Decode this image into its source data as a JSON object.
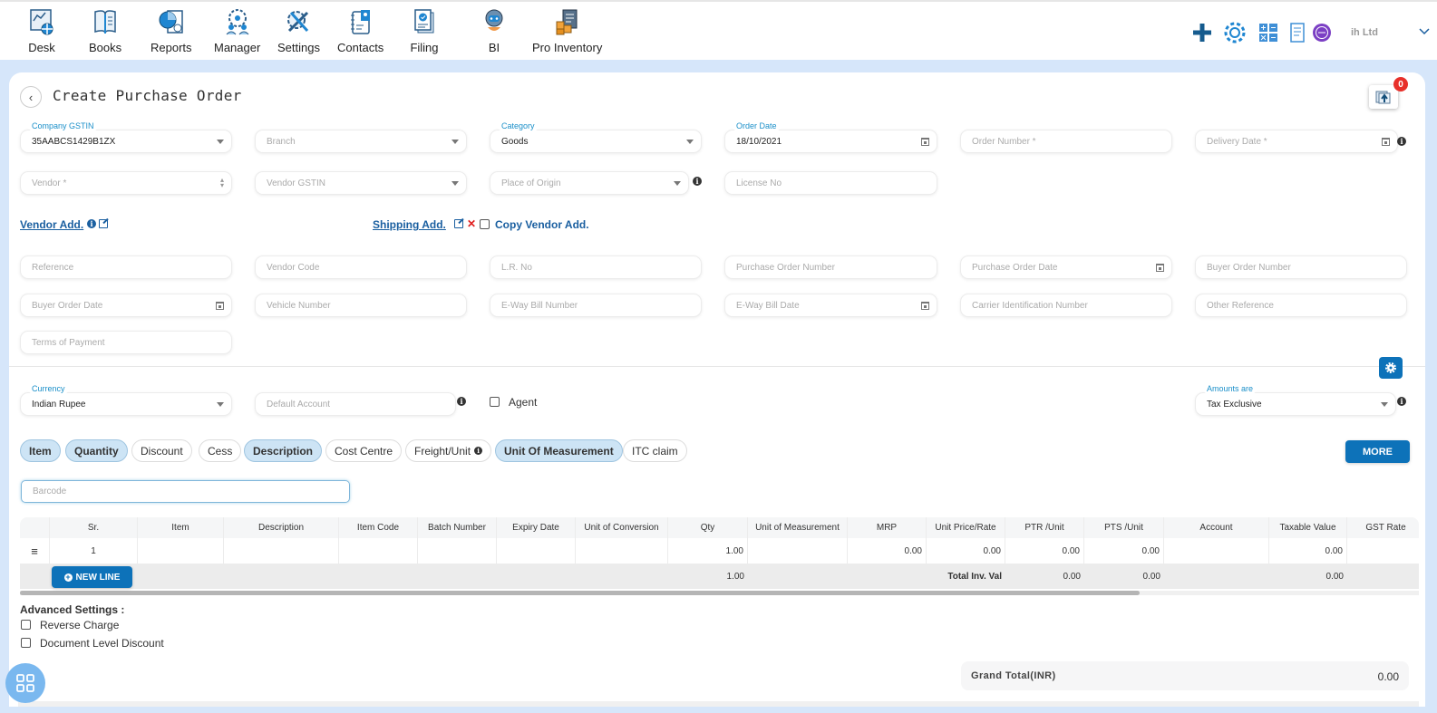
{
  "nav": {
    "items": [
      {
        "label": "Desk",
        "icon": "desk-icon"
      },
      {
        "label": "Books",
        "icon": "books-icon"
      },
      {
        "label": "Reports",
        "icon": "reports-icon"
      },
      {
        "label": "Manager",
        "icon": "manager-icon"
      },
      {
        "label": "Settings",
        "icon": "settings-icon"
      },
      {
        "label": "Contacts",
        "icon": "contacts-icon"
      },
      {
        "label": "Filing",
        "icon": "filing-icon"
      },
      {
        "label": "BI",
        "icon": "bi-robot-icon"
      },
      {
        "label": "Pro Inventory",
        "icon": "pro-inventory-icon"
      }
    ],
    "company": "ih Ltd"
  },
  "page": {
    "title": "Create Purchase Order",
    "upload_badge_count": "0"
  },
  "form": {
    "company_gstin": {
      "label": "Company GSTIN",
      "value": "35AABCS1429B1ZX"
    },
    "branch": {
      "placeholder": "Branch"
    },
    "category": {
      "label": "Category",
      "value": "Goods"
    },
    "order_date": {
      "label": "Order Date",
      "value": "18/10/2021"
    },
    "order_number": {
      "placeholder": "Order Number *"
    },
    "delivery_date": {
      "placeholder": "Delivery Date *"
    },
    "vendor": {
      "placeholder": "Vendor *"
    },
    "vendor_gstin": {
      "placeholder": "Vendor GSTIN"
    },
    "place_of_origin": {
      "placeholder": "Place of Origin"
    },
    "license_no": {
      "placeholder": "License No"
    },
    "vendor_add": "Vendor Add.",
    "shipping_add": "Shipping Add.",
    "copy_vendor_add": "Copy Vendor Add.",
    "reference": {
      "placeholder": "Reference"
    },
    "vendor_code": {
      "placeholder": "Vendor Code"
    },
    "lr_no": {
      "placeholder": "L.R. No"
    },
    "purchase_order_number": {
      "placeholder": "Purchase Order Number"
    },
    "purchase_order_date": {
      "placeholder": "Purchase Order Date"
    },
    "buyer_order_number": {
      "placeholder": "Buyer Order Number"
    },
    "buyer_order_date": {
      "placeholder": "Buyer Order Date"
    },
    "vehicle_number": {
      "placeholder": "Vehicle Number"
    },
    "eway_bill_number": {
      "placeholder": "E-Way Bill Number"
    },
    "eway_bill_date": {
      "placeholder": "E-Way Bill Date"
    },
    "carrier_id": {
      "placeholder": "Carrier Identification Number"
    },
    "other_reference": {
      "placeholder": "Other Reference"
    },
    "terms_of_payment": {
      "placeholder": "Terms of Payment"
    },
    "currency": {
      "label": "Currency",
      "value": "Indian Rupee"
    },
    "default_account": {
      "placeholder": "Default Account"
    },
    "agent": "Agent",
    "amounts_are": {
      "label": "Amounts are",
      "value": "Tax Exclusive"
    }
  },
  "chips": [
    {
      "label": "Item",
      "active": true
    },
    {
      "label": "Quantity",
      "active": true
    },
    {
      "label": "Discount",
      "active": false
    },
    {
      "label": "Cess",
      "active": false
    },
    {
      "label": "Description",
      "active": true
    },
    {
      "label": "Cost Centre",
      "active": false
    },
    {
      "label": "Freight/Unit",
      "active": false
    },
    {
      "label": "Unit Of Measurement",
      "active": true
    },
    {
      "label": "ITC claim",
      "active": false
    }
  ],
  "more_label": "MORE",
  "barcode": {
    "placeholder": "Barcode"
  },
  "table": {
    "columns": [
      "",
      "Sr.",
      "Item",
      "Description",
      "Item Code",
      "Batch Number",
      "Expiry Date",
      "Unit of Conversion",
      "Qty",
      "Unit of Measurement",
      "MRP",
      "Unit Price/Rate",
      "PTR /Unit",
      "PTS /Unit",
      "Account",
      "Taxable Value",
      "GST Rate"
    ],
    "rows": [
      [
        "",
        "1",
        "",
        "",
        "",
        "",
        "",
        "",
        "1.00",
        "",
        "0.00",
        "0.00",
        "0.00",
        "0.00",
        "",
        "0.00",
        ""
      ]
    ],
    "footer": {
      "qty_total": "1.00",
      "total_label": "Total Inv. Val",
      "ptr_total": "0.00",
      "pts_total": "0.00",
      "taxable_total": "0.00"
    },
    "new_line_label": "NEW LINE"
  },
  "advanced": {
    "title": "Advanced Settings :",
    "options": [
      "Reverse Charge",
      "Document Level Discount"
    ]
  },
  "grand_total": {
    "label": "Grand Total(INR)",
    "value": "0.00"
  },
  "colors": {
    "primary": "#0d72b9",
    "chip_active": "#cde4f5",
    "label_blue": "#1a8fc9",
    "badge_red": "#e8302a"
  }
}
